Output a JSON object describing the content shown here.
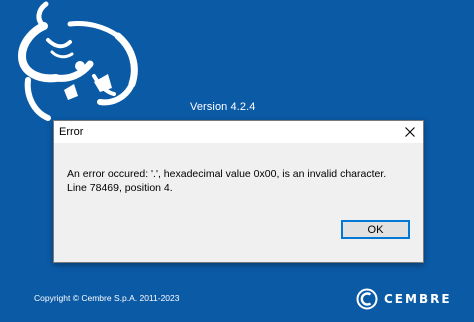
{
  "splash": {
    "version_text": "Version  4.2.4",
    "copyright": "Copyright © Cembre S.p.A. 2011-2023",
    "brand": {
      "name": "CEMBRE",
      "logo_icon": "cembre-c-logo-icon"
    },
    "illustration_icon": "genie-lamp-icon",
    "background_color": "#0b5aa6"
  },
  "dialog": {
    "title": "Error",
    "close_icon": "close-icon",
    "message_line1": "An error occured: '.', hexadecimal value 0x00, is an invalid character.",
    "message_line2": "Line 78469, position 4.",
    "ok_label": "OK",
    "accent_color": "#0078d7"
  }
}
